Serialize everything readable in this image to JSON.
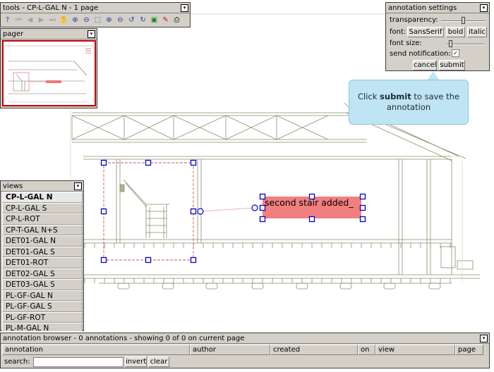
{
  "tools": {
    "title": "tools - CP-L-GAL N - 1 page",
    "collapse": "▾",
    "buttons": [
      {
        "name": "help-icon",
        "glyph": "?",
        "cls": "blue"
      },
      {
        "name": "first-page-icon",
        "glyph": "⏮",
        "cls": "dim"
      },
      {
        "name": "prev-page-icon",
        "glyph": "◀",
        "cls": "dim"
      },
      {
        "name": "next-page-icon",
        "glyph": "▶",
        "cls": "dim"
      },
      {
        "name": "last-page-icon",
        "glyph": "⏭",
        "cls": "dim"
      },
      {
        "name": "pan-icon",
        "glyph": "✋",
        "cls": ""
      },
      {
        "name": "zoom-in-icon",
        "glyph": "⊕",
        "cls": "blue"
      },
      {
        "name": "zoom-out-icon",
        "glyph": "⊖",
        "cls": "blue"
      },
      {
        "name": "zoom-window-icon",
        "glyph": "⬚",
        "cls": "blue"
      },
      {
        "name": "zoom-fit-icon",
        "glyph": "⊕",
        "cls": "blue"
      },
      {
        "name": "zoom-extents-icon",
        "glyph": "⊖",
        "cls": "blue"
      },
      {
        "name": "rotate-ccw-icon",
        "glyph": "↺",
        "cls": "blue"
      },
      {
        "name": "rotate-cw-icon",
        "glyph": "↻",
        "cls": "blue"
      },
      {
        "name": "image-icon",
        "glyph": "▣",
        "cls": "green"
      },
      {
        "name": "markup-icon",
        "glyph": "✎",
        "cls": "red"
      },
      {
        "name": "print-icon",
        "glyph": "⎙",
        "cls": ""
      }
    ]
  },
  "pager": {
    "title": "pager",
    "collapse": "▾"
  },
  "views": {
    "title": "views",
    "collapse": "▾",
    "items": [
      "CP-L-GAL N",
      "CP-L-GAL S",
      "CP-L-ROT",
      "CP-T-GAL N+S",
      "DET01-GAL N",
      "DET01-GAL S",
      "DET01-ROT",
      "DET02-GAL S",
      "DET03-GAL S",
      "PL-GF-GAL N",
      "PL-GF-GAL S",
      "PL-GF-ROT",
      "PL-M-GAL N"
    ],
    "selected_index": 0
  },
  "settings": {
    "title": "annotation settings",
    "collapse": "▾",
    "transparency_label": "transparency:",
    "transparency_value": 0.5,
    "font_label": "font:",
    "font_family": "SansSerif",
    "bold": "bold",
    "italic": "italic",
    "font_size_label": "font size:",
    "font_size_value": 0.08,
    "notify_label": "send notification:",
    "notify_checked": "✓",
    "cancel": "cancel",
    "submit": "submit"
  },
  "tooltip": {
    "prefix": "Click ",
    "keyword": "submit",
    "suffix": " to save the annotation"
  },
  "annotation": {
    "text": "second stair added_",
    "fill": "#f07878"
  },
  "browser": {
    "title": "annotation browser - 0 annotations - showing 0 of 0 on current page",
    "collapse": "▾",
    "columns": [
      "annotation",
      "author",
      "created",
      "on",
      "view",
      "page"
    ],
    "search_label": "search:",
    "search_value": "",
    "invert": "invert",
    "clear": "clear"
  },
  "colors": {
    "panel": "#d4d0c8",
    "drawing_line": "#8c8c6e",
    "handle": "#0000cc",
    "cloud": "#e05050",
    "tooltip": "#bfe4f4"
  }
}
